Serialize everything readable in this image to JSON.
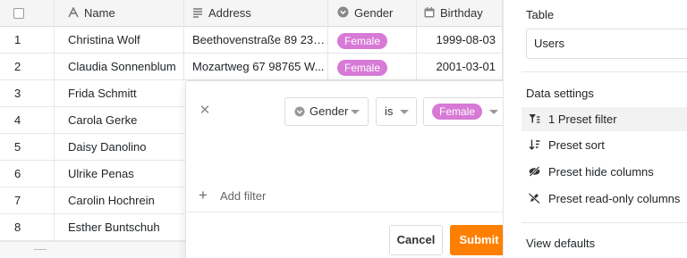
{
  "table": {
    "columns": [
      {
        "label": "Name",
        "icon": "text-icon"
      },
      {
        "label": "Address",
        "icon": "text-lines-icon"
      },
      {
        "label": "Gender",
        "icon": "single-select-icon"
      },
      {
        "label": "Birthday",
        "icon": "calendar-icon"
      }
    ],
    "rows": [
      {
        "index": "1",
        "name": "Christina Wolf",
        "address": "Beethovenstraße 89 234...",
        "gender": "Female",
        "birthday": "1999-08-03"
      },
      {
        "index": "2",
        "name": "Claudia Sonnenblum",
        "address": "Mozartweg 67 98765 W...",
        "gender": "Female",
        "birthday": "2001-03-01"
      },
      {
        "index": "3",
        "name": "Frida Schmitt"
      },
      {
        "index": "4",
        "name": "Carola Gerke"
      },
      {
        "index": "5",
        "name": "Daisy Danolino"
      },
      {
        "index": "6",
        "name": "Ulrike Penas"
      },
      {
        "index": "7",
        "name": "Carolin Hochrein"
      },
      {
        "index": "8",
        "name": "Esther Buntschuh"
      }
    ],
    "pill_color": "#d77ad6"
  },
  "filter": {
    "column": "Gender",
    "operator": "is",
    "value": "Female",
    "add_filter_label": "Add filter",
    "cancel_label": "Cancel",
    "submit_label": "Submit",
    "submit_color": "#ff8000"
  },
  "panel": {
    "table_label": "Table",
    "table_value": "Users",
    "data_settings_label": "Data settings",
    "items": [
      {
        "label": "1 Preset filter",
        "icon": "filter-icon"
      },
      {
        "label": "Preset sort",
        "icon": "sort-icon"
      },
      {
        "label": "Preset hide columns",
        "icon": "eye-off-icon"
      },
      {
        "label": "Preset read-only columns",
        "icon": "pen-off-icon"
      }
    ],
    "view_defaults_label": "View defaults"
  }
}
